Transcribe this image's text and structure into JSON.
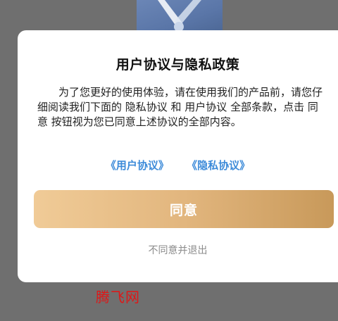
{
  "background": {
    "image_icon": "tools-icon"
  },
  "dialog": {
    "title": "用户协议与隐私政策",
    "body": "为了您更好的使用体验，请在使用我们的产品前，请您仔细阅读我们下面的 隐私协议 和 用户协议 全部条款，点击 同意 按钮视为您已同意上述协议的全部内容。",
    "links": {
      "user_agreement": "《用户协议》",
      "privacy_agreement": "《隐私协议》"
    },
    "agree_label": "同意",
    "disagree_label": "不同意并退出"
  },
  "watermark": "腾飞网",
  "colors": {
    "overlay": "#6f6f6f",
    "link": "#3d8bd9",
    "button_gradient_start": "#f0cb97",
    "button_gradient_end": "#c8995a",
    "watermark": "#e01616"
  }
}
